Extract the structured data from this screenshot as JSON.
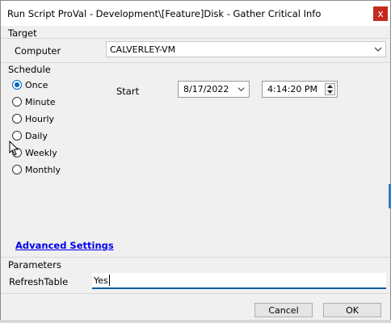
{
  "window": {
    "title": "Run Script ProVal - Development\\[Feature]Disk - Gather Critical Info",
    "close_label": "x"
  },
  "target": {
    "section_label": "Target",
    "computer_label": "Computer",
    "computer_value": "CALVERLEY-VM"
  },
  "schedule": {
    "section_label": "Schedule",
    "options": [
      "Once",
      "Minute",
      "Hourly",
      "Daily",
      "Weekly",
      "Monthly"
    ],
    "selected": "Once",
    "start_label": "Start",
    "start_date": "8/17/2022",
    "start_time": "4:14:20 PM"
  },
  "advanced_settings_label": "Advanced Settings",
  "parameters": {
    "section_label": "Parameters",
    "refresh_label": "RefreshTable",
    "refresh_value": "Yes"
  },
  "buttons": {
    "cancel": "Cancel",
    "ok": "OK"
  },
  "colors": {
    "accent": "#0067c0",
    "close": "#c42b1c",
    "link": "#0000ee",
    "input_focus": "#005a9e"
  },
  "icons": {
    "close": "close-icon",
    "dropdown": "chevron-down-icon",
    "spin_up": "chevron-up-icon",
    "spin_down": "chevron-down-icon",
    "mouse_pointer": "mouse-pointer-icon"
  }
}
